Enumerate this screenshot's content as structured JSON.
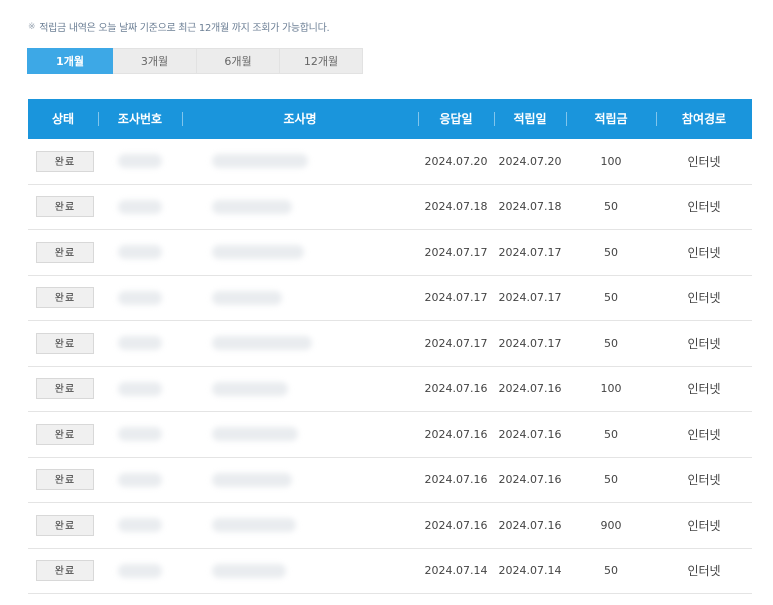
{
  "notice": {
    "mark": "※",
    "text": "적립금 내역은 오늘 날짜 기준으로 최근 12개월 까지 조회가 가능합니다."
  },
  "tabs": [
    {
      "label": "1개월",
      "active": true
    },
    {
      "label": "3개월",
      "active": false
    },
    {
      "label": "6개월",
      "active": false
    },
    {
      "label": "12개월",
      "active": false
    }
  ],
  "table": {
    "headers": [
      "상태",
      "조사번호",
      "조사명",
      "응답일",
      "적립일",
      "적립금",
      "참여경로"
    ],
    "rows": [
      {
        "status": "완료",
        "response_date": "2024.07.20",
        "earned_date": "2024.07.20",
        "amount": "100",
        "route": "인터넷"
      },
      {
        "status": "완료",
        "response_date": "2024.07.18",
        "earned_date": "2024.07.18",
        "amount": "50",
        "route": "인터넷"
      },
      {
        "status": "완료",
        "response_date": "2024.07.17",
        "earned_date": "2024.07.17",
        "amount": "50",
        "route": "인터넷"
      },
      {
        "status": "완료",
        "response_date": "2024.07.17",
        "earned_date": "2024.07.17",
        "amount": "50",
        "route": "인터넷"
      },
      {
        "status": "완료",
        "response_date": "2024.07.17",
        "earned_date": "2024.07.17",
        "amount": "50",
        "route": "인터넷"
      },
      {
        "status": "완료",
        "response_date": "2024.07.16",
        "earned_date": "2024.07.16",
        "amount": "100",
        "route": "인터넷"
      },
      {
        "status": "완료",
        "response_date": "2024.07.16",
        "earned_date": "2024.07.16",
        "amount": "50",
        "route": "인터넷"
      },
      {
        "status": "완료",
        "response_date": "2024.07.16",
        "earned_date": "2024.07.16",
        "amount": "50",
        "route": "인터넷"
      },
      {
        "status": "완료",
        "response_date": "2024.07.16",
        "earned_date": "2024.07.16",
        "amount": "900",
        "route": "인터넷"
      },
      {
        "status": "완료",
        "response_date": "2024.07.14",
        "earned_date": "2024.07.14",
        "amount": "50",
        "route": "인터넷"
      }
    ]
  },
  "colors": {
    "header_bg": "#1a95dc",
    "active_tab_bg": "#3da8e6"
  }
}
